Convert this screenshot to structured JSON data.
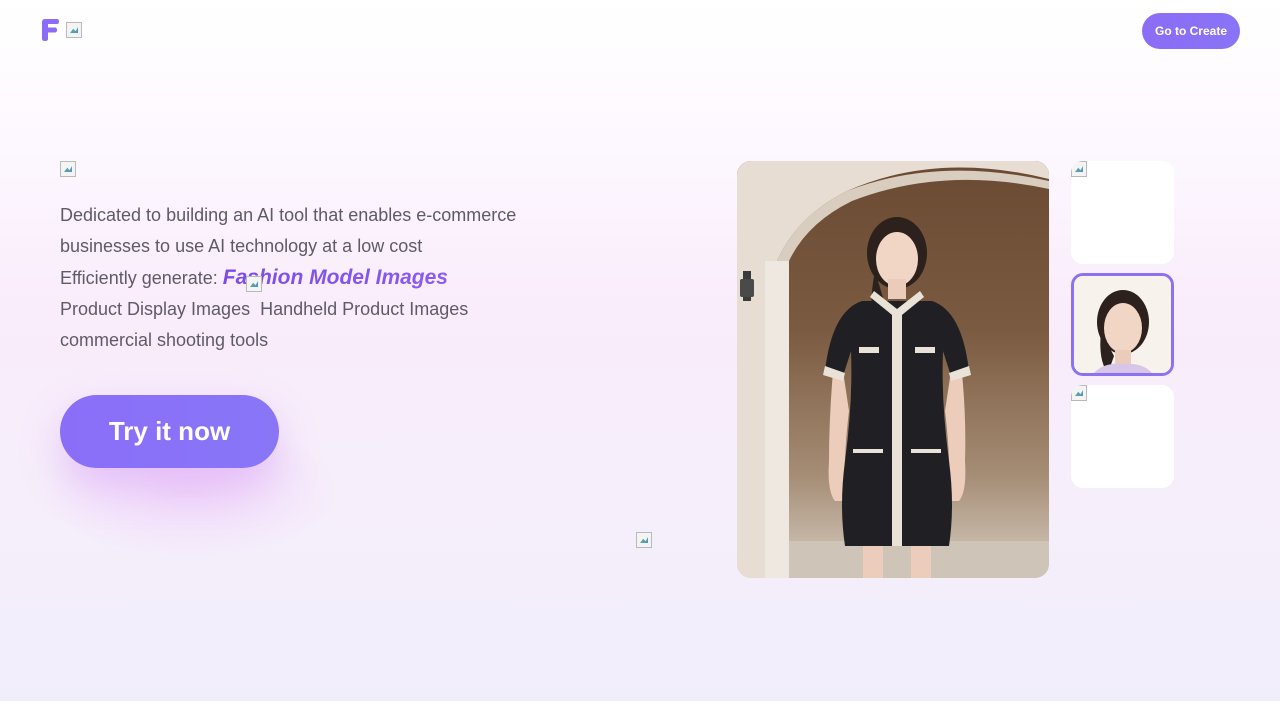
{
  "header": {
    "go_create_label": "Go to Create"
  },
  "hero": {
    "line1": "Dedicated to building an AI tool that enables e-commerce",
    "line2": "businesses to use AI technology at a low cost",
    "generate_prefix": "Efficiently generate:",
    "highlight": "Fashion Model Images",
    "line4a": "Product Display Images",
    "line4b": "Handheld Product Images",
    "line5": "commercial shooting tools",
    "cta_label": "Try it now"
  },
  "colors": {
    "accent": "#8b6cf6",
    "highlight": "#7b4be8",
    "text": "#5f5b66"
  },
  "icons": {
    "logo": "f-logo-icon",
    "broken_image": "broken-image-icon"
  }
}
